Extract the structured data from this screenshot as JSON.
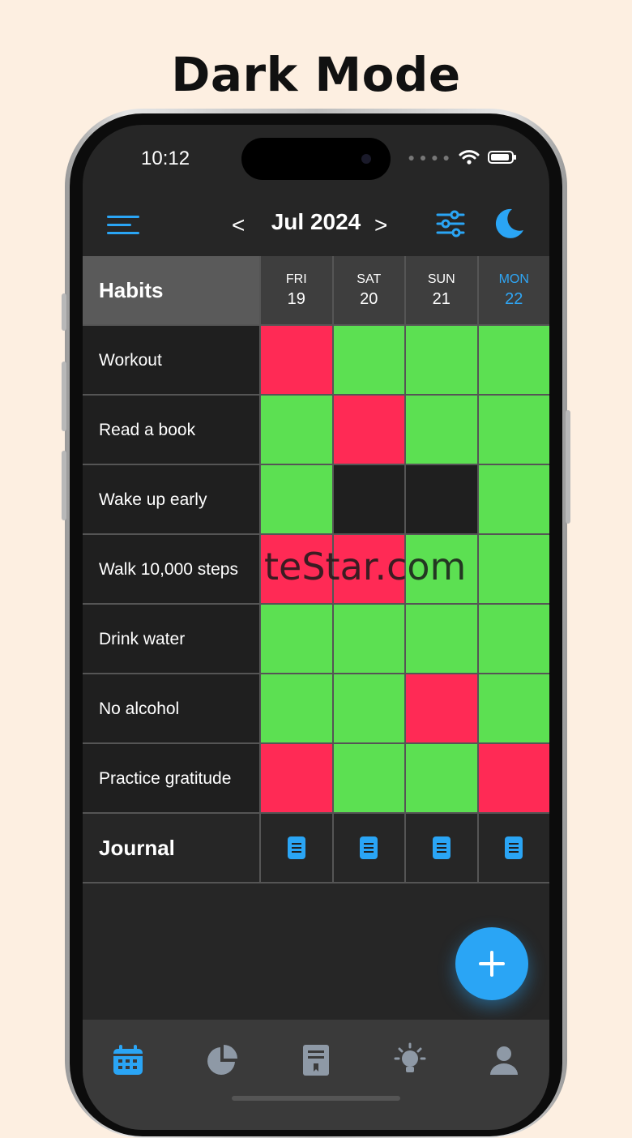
{
  "caption": "Dark Mode",
  "status_bar": {
    "time": "10:12"
  },
  "toolbar": {
    "month": "Jul 2024",
    "prev_symbol": "<",
    "next_symbol": ">",
    "menu_icon": "hamburger-menu-icon",
    "filter_icon": "sliders-icon",
    "theme_icon": "moon-icon"
  },
  "grid": {
    "header_label": "Habits",
    "days": [
      {
        "label": "FRI",
        "num": "19",
        "today": false
      },
      {
        "label": "SAT",
        "num": "20",
        "today": false
      },
      {
        "label": "SUN",
        "num": "21",
        "today": false
      },
      {
        "label": "MON",
        "num": "22",
        "today": true
      }
    ],
    "habits": [
      {
        "name": "Workout",
        "marks": [
          "missed",
          "done",
          "done",
          "done"
        ]
      },
      {
        "name": "Read a book",
        "marks": [
          "done",
          "missed",
          "done",
          "done"
        ]
      },
      {
        "name": "Wake up early",
        "marks": [
          "done",
          "empty",
          "empty",
          "done"
        ]
      },
      {
        "name": "Walk 10,000 steps",
        "marks": [
          "missed",
          "missed",
          "done",
          "done"
        ]
      },
      {
        "name": "Drink water",
        "marks": [
          "done",
          "done",
          "done",
          "done"
        ]
      },
      {
        "name": "No alcohol",
        "marks": [
          "done",
          "done",
          "missed",
          "done"
        ]
      },
      {
        "name": "Practice gratitude",
        "marks": [
          "missed",
          "done",
          "done",
          "missed"
        ]
      }
    ],
    "journal_label": "Journal",
    "journal_icon": "document-icon"
  },
  "watermark": "teStar.com",
  "fab_icon": "plus-icon",
  "tabs": [
    "calendar-icon",
    "pie-chart-icon",
    "journal-book-icon",
    "lightbulb-icon",
    "profile-icon"
  ],
  "colors": {
    "accent": "#2aa5f5",
    "done": "#5ce052",
    "missed": "#ff2a55",
    "background": "#262626",
    "page": "#fdefe1"
  }
}
